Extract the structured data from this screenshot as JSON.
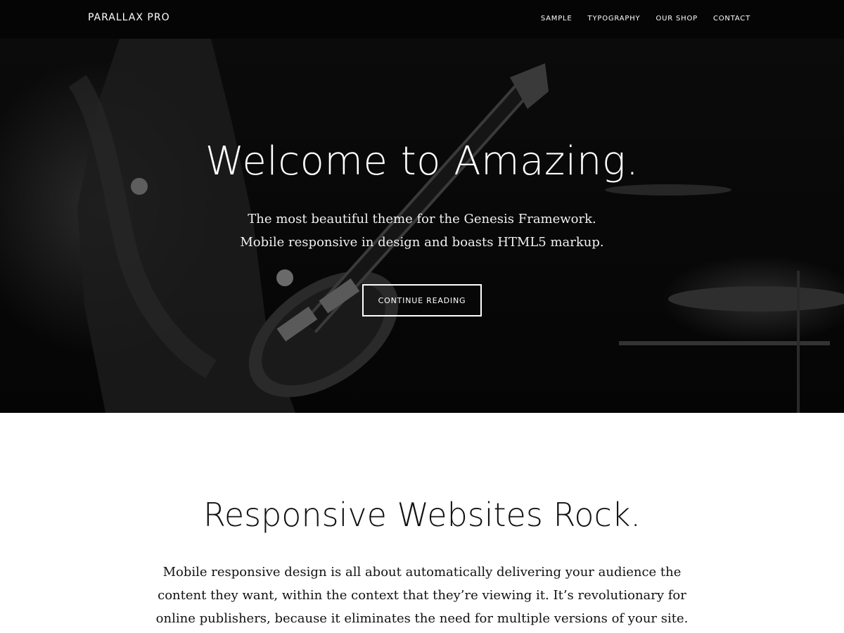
{
  "header": {
    "site_title": "PARALLAX PRO",
    "nav": [
      "SAMPLE",
      "TYPOGRAPHY",
      "OUR SHOP",
      "CONTACT"
    ]
  },
  "hero": {
    "title": "Welcome to Amazing.",
    "subtitle_line1": "The most beautiful theme for the Genesis Framework.",
    "subtitle_line2": "Mobile responsive in design and boasts HTML5 markup.",
    "button_label": "CONTINUE READING"
  },
  "section": {
    "title": "Responsive Websites Rock.",
    "text": "Mobile responsive design is all about automatically delivering your audience the content they want, within the context that they’re viewing it. It’s revolutionary for online publishers, because it eliminates the need for multiple versions of your site."
  },
  "colors": {
    "header_bg": "#050505",
    "hero_bg": "#0b0b0b",
    "text_light": "#ffffff",
    "text_dark": "#111111"
  }
}
